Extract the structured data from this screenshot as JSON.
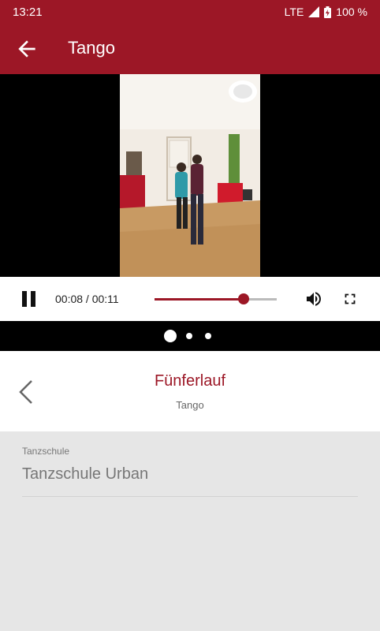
{
  "status": {
    "time": "13:21",
    "network": "LTE",
    "battery": "100 %"
  },
  "appbar": {
    "title": "Tango",
    "back_icon": "arrow-left-icon"
  },
  "player": {
    "current": "00:08",
    "separator": " / ",
    "duration": "00:11",
    "progress": 0.73
  },
  "pager": {
    "count": 3,
    "active": 0
  },
  "figure": {
    "name": "Fünferlauf",
    "dance": "Tango"
  },
  "details": {
    "label": "Tanzschule",
    "value": "Tanzschule Urban"
  },
  "colors": {
    "primary": "#9c1726"
  }
}
